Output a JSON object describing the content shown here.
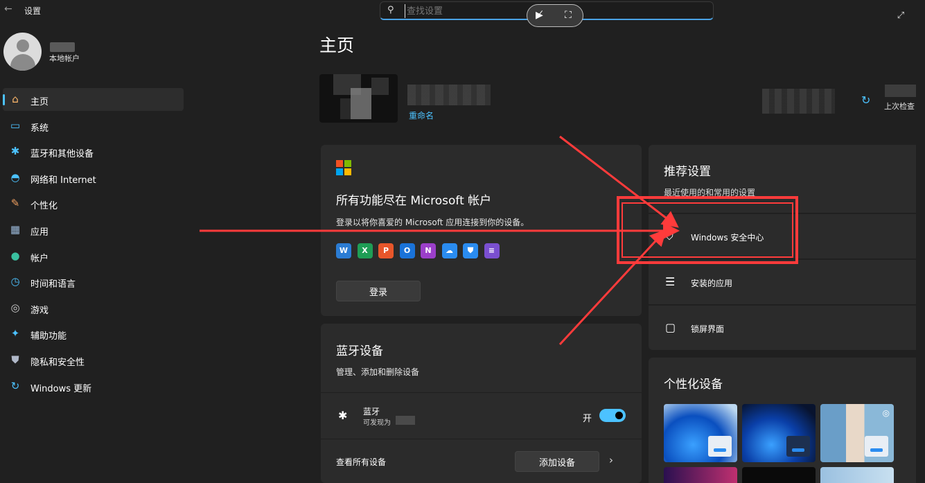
{
  "titlebar": {
    "back_glyph": "←",
    "app_title": "设置",
    "search_placeholder": "查找设置",
    "pill_icon_1": "▶̸",
    "pill_icon_2": "⛶"
  },
  "profile": {
    "account_type": "本地帐户"
  },
  "sidebar": {
    "items": [
      {
        "label": "主页",
        "icon": "home-icon",
        "glyph": "⌂",
        "color": "#ffb86b"
      },
      {
        "label": "系统",
        "icon": "system-icon",
        "glyph": "▭",
        "color": "#4cc2ff"
      },
      {
        "label": "蓝牙和其他设备",
        "icon": "bluetooth-icon",
        "glyph": "✱",
        "color": "#4cc2ff"
      },
      {
        "label": "网络和 Internet",
        "icon": "wifi-icon",
        "glyph": "◓",
        "color": "#4cc2ff"
      },
      {
        "label": "个性化",
        "icon": "brush-icon",
        "glyph": "✎",
        "color": "#f0a060"
      },
      {
        "label": "应用",
        "icon": "apps-icon",
        "glyph": "▦",
        "color": "#9ab8d8"
      },
      {
        "label": "帐户",
        "icon": "account-icon",
        "glyph": "●",
        "color": "#3ac0a0"
      },
      {
        "label": "时间和语言",
        "icon": "globe-clock-icon",
        "glyph": "◷",
        "color": "#4cc2ff"
      },
      {
        "label": "游戏",
        "icon": "gamepad-icon",
        "glyph": "◎",
        "color": "#cfcfcf"
      },
      {
        "label": "辅助功能",
        "icon": "accessibility-icon",
        "glyph": "✦",
        "color": "#4cc2ff"
      },
      {
        "label": "隐私和安全性",
        "icon": "shield-icon",
        "glyph": "⛊",
        "color": "#b0b8c8"
      },
      {
        "label": "Windows 更新",
        "icon": "update-icon",
        "glyph": "↻",
        "color": "#4cc2ff"
      }
    ]
  },
  "main": {
    "title": "主页",
    "device": {
      "rename_link": "重命名",
      "last_check": "上次检查"
    },
    "ms_card": {
      "title": "所有功能尽在 Microsoft 帐户",
      "desc": "登录以将你喜爱的 Microsoft 应用连接到你的设备。",
      "signin": "登录",
      "apps": [
        {
          "icon": "word-icon",
          "letter": "W",
          "color": "#2b7cd3"
        },
        {
          "icon": "excel-icon",
          "letter": "X",
          "color": "#1f9d55"
        },
        {
          "icon": "powerpoint-icon",
          "letter": "P",
          "color": "#e8562a"
        },
        {
          "icon": "outlook-icon",
          "letter": "O",
          "color": "#1a73d9"
        },
        {
          "icon": "onenote-icon",
          "letter": "N",
          "color": "#9b3fc9"
        },
        {
          "icon": "onedrive-icon",
          "letter": "☁",
          "color": "#2a8cf0"
        },
        {
          "icon": "defender-icon",
          "letter": "⛊",
          "color": "#2a8cf0"
        },
        {
          "icon": "clipchamp-icon",
          "letter": "≡",
          "color": "#7a4fd0"
        }
      ]
    },
    "bt_card": {
      "title": "蓝牙设备",
      "desc": "管理、添加和删除设备",
      "bt_name": "蓝牙",
      "bt_discover": "可发现为",
      "bt_state": "开",
      "all_devices": "查看所有设备",
      "add_device": "添加设备"
    },
    "recommended": {
      "title": "推荐设置",
      "desc": "最近使用的和常用的设置",
      "rows": [
        {
          "label": "Windows 安全中心",
          "icon": "shield-outline-icon",
          "glyph": "⛉"
        },
        {
          "label": "安装的应用",
          "icon": "list-icon",
          "glyph": "☰"
        },
        {
          "label": "锁屏界面",
          "icon": "lockscreen-icon",
          "glyph": "▢"
        }
      ]
    },
    "personalize": {
      "title": "个性化设备"
    }
  },
  "colors": {
    "accent": "#4cc2ff",
    "annotation": "#ff3b3b",
    "card": "#2b2b2b",
    "bg": "#202020"
  }
}
